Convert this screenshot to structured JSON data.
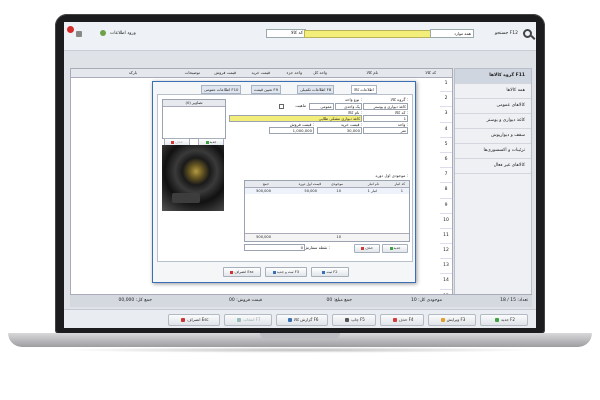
{
  "topbar": {
    "search_label": "جستجو F12",
    "search_combo": "همه موارد",
    "type_combo": "کد کالا",
    "login_label": "ورود اطلاعات"
  },
  "grid": {
    "headers": [
      "کد کالا",
      "نام کالا",
      "واحد کل",
      "واحد جزء",
      "قیمت خرید",
      "قیمت فروش",
      "توضیحات",
      "بارکد"
    ],
    "row_numbers": [
      "1",
      "2",
      "3",
      "4",
      "5",
      "6",
      "7",
      "8",
      "9",
      "10",
      "11",
      "12",
      "13",
      "14",
      "15"
    ]
  },
  "sidebar": {
    "header": "گروه کالاها F11",
    "items": [
      "همه کالاها",
      "کالاهای عمومی",
      "کاغذ دیواری و پوستر",
      "سقف و دیوارپوش",
      "تزئینات و اکسسوری‌ها",
      "کالاهای غیر فعال"
    ]
  },
  "status_strip": {
    "count": "تعداد: 15 / 18",
    "units_total": "موجودی کل: 10",
    "fee_total": "جمع مبلغ: 00",
    "selected_price": "قیمت فروش: 00",
    "total_amount": "جمع کل: 00,000"
  },
  "footer": {
    "new": "جدید F2",
    "edit": "ویرایش F3",
    "delete": "حذف F4",
    "print": "چاپ F5",
    "report": "گزارش کالا F6",
    "disabled_btn": "انتخاب F7",
    "exit": "انصراف Esc"
  },
  "dialog": {
    "tabs": [
      "اطلاعات کالا",
      "اطلاعات تکمیلی F8",
      "تعیین قیمت F9",
      "اطلاعات عمومی F10"
    ],
    "group_label": "گروه کالا :",
    "group_value": "کاغذ دیواری و پوستر",
    "unit_type_label": "نوع واحد :",
    "unit_type_value": "یک واحدی",
    "general_unit_value": "عمومی",
    "unit_chk_label": "ماهیت",
    "code_label": "کد کالا :",
    "code_value": "1",
    "name_label": "نام کالا :",
    "name_value": "کاغذ دیواری مشکی طلایی",
    "unit_label": "واحد :",
    "unit_value": "متر",
    "buy_price_label": "قیمت خرید :",
    "buy_price_value": "30,000",
    "sell_price_label": "قیمت فروش :",
    "sell_price_value": "1,000,000",
    "inventory_label": "موجودی اول دوره :",
    "image_list_header": "تصاویر (0)",
    "img_new": "جدید",
    "img_delete": "حذف",
    "inner_grid": {
      "headers": [
        "کد انبار",
        "نام انبار",
        "موجودی",
        "قیمت اول دوره",
        "جمع"
      ],
      "row": {
        "num": "1",
        "warehouse": "انبار 1",
        "qty": "10",
        "price": "50,000",
        "total": "500,000"
      },
      "sum_qty": "10",
      "sum_total": "500,000"
    },
    "min_stock_label": "نقطه سفارش :",
    "min_stock_value": "0",
    "grid_new": "جدید",
    "grid_delete": "حذف",
    "save": "ثبت F2",
    "save_new": "ثبت و جدید F3",
    "cancel": "انصراف Esc"
  }
}
